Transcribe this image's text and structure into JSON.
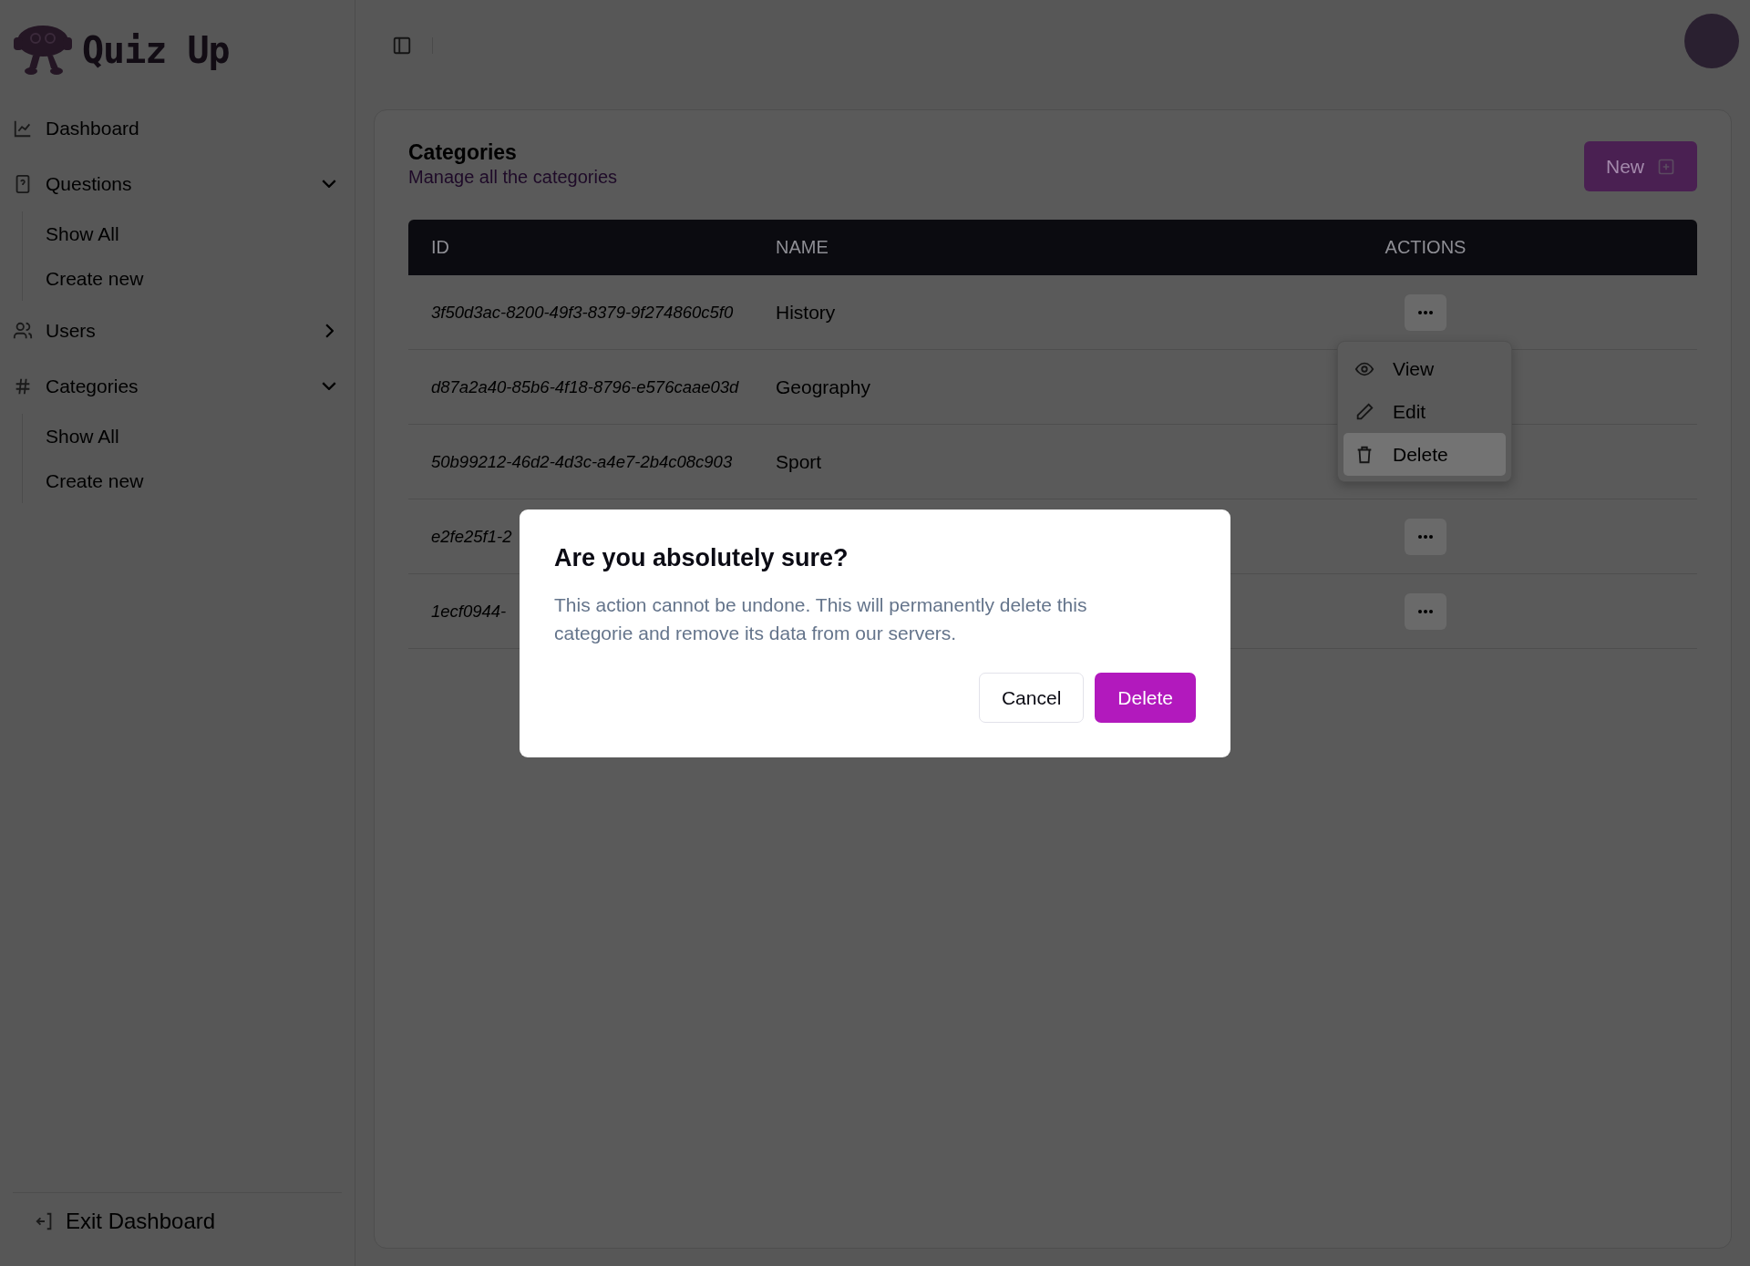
{
  "app": {
    "logo_text": "Quiz Up"
  },
  "sidebar": {
    "items": [
      {
        "label": "Dashboard",
        "kind": "link"
      },
      {
        "label": "Questions",
        "kind": "group",
        "expanded": true,
        "children": [
          {
            "label": "Show All"
          },
          {
            "label": "Create new"
          }
        ]
      },
      {
        "label": "Users",
        "kind": "group",
        "expanded": false
      },
      {
        "label": "Categories",
        "kind": "group",
        "expanded": true,
        "children": [
          {
            "label": "Show All"
          },
          {
            "label": "Create new"
          }
        ]
      }
    ],
    "footer": {
      "label": "Exit Dashboard"
    }
  },
  "page": {
    "title": "Categories",
    "subtitle": "Manage all the categories",
    "new_button": "New"
  },
  "table": {
    "columns": [
      "ID",
      "NAME",
      "ACTIONS"
    ],
    "rows": [
      {
        "id": "3f50d3ac-8200-49f3-8379-9f274860c5f0",
        "name": "History",
        "actions_button": true
      },
      {
        "id": "d87a2a40-85b6-4f18-8796-e576caae03d",
        "name": "Geography",
        "actions_button": false
      },
      {
        "id": "50b99212-46d2-4d3c-a4e7-2b4c08c903",
        "name": "Sport",
        "actions_button": false
      },
      {
        "id": "e2fe25f1-2",
        "actions_button": true
      },
      {
        "id": "1ecf0944-",
        "actions_button": true
      }
    ]
  },
  "row_menu": {
    "items": [
      {
        "label": "View",
        "selected": false
      },
      {
        "label": "Edit",
        "selected": false
      },
      {
        "label": "Delete",
        "selected": true
      }
    ]
  },
  "dialog": {
    "title": "Are you absolutely sure?",
    "description": "This action cannot be undone. This will permanently delete this categorie and remove its data from our servers.",
    "cancel": "Cancel",
    "confirm": "Delete"
  }
}
